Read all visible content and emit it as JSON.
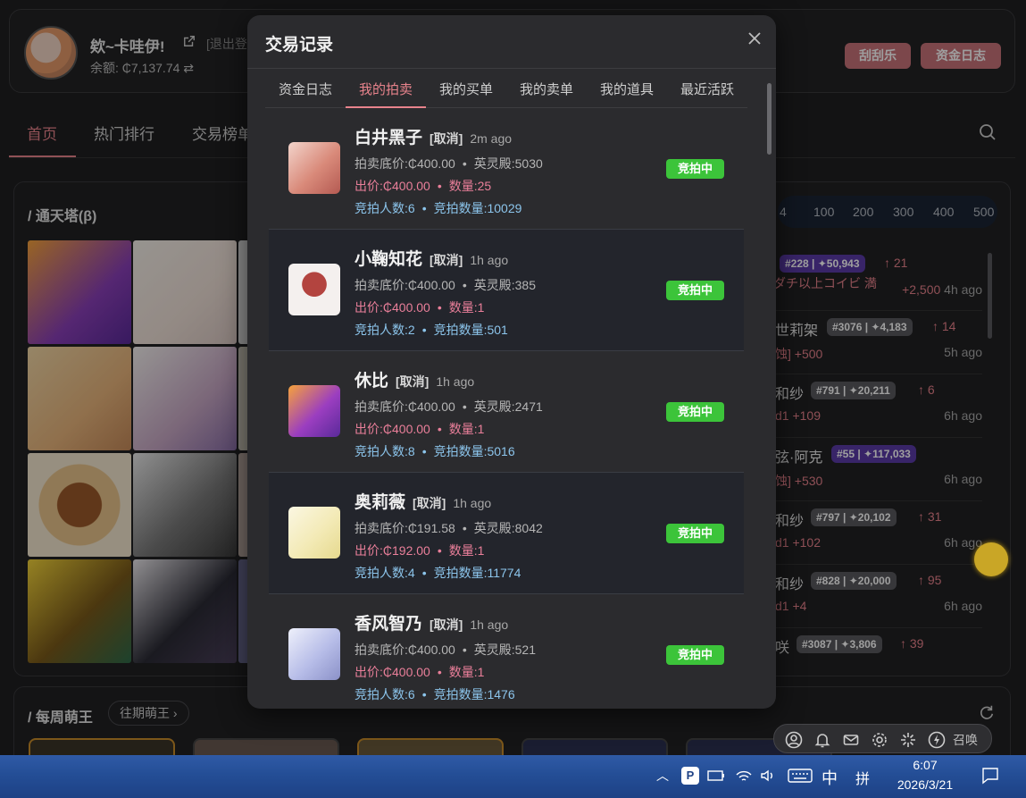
{
  "header": {
    "user_name": "欸~卡哇伊!",
    "logout": "[退出登",
    "balance": "余额: ₵7,137.74 ⇄",
    "buttons": [
      "刮刮乐",
      "资金日志"
    ]
  },
  "nav": {
    "items": [
      "首页",
      "热门排行",
      "交易榜单"
    ],
    "active": "首页"
  },
  "tower": {
    "title": "/ 通天塔(β)",
    "pager": [
      "4",
      "100",
      "200",
      "300",
      "400",
      "500"
    ]
  },
  "ranking": [
    {
      "name": "",
      "badge_no": "#228",
      "badge_val": "50,943",
      "up": "↑ 21",
      "sub": "モダチ以上コイビ 満",
      "extra": "+2,500",
      "time": "4h ago",
      "badge_color": "#5b3aa8"
    },
    {
      "name": "世莉架",
      "badge_no": "#3076",
      "badge_val": "4,183",
      "up": "↑ 14",
      "sub": "蚀] +500",
      "extra": "",
      "time": "5h ago",
      "badge_color": "#5a5a5e"
    },
    {
      "name": "和纱",
      "badge_no": "#791",
      "badge_val": "20,211",
      "up": "↑ 6",
      "sub": "d1 +109",
      "extra": "",
      "time": "6h ago",
      "badge_color": "#5a5a5e"
    },
    {
      "name": "弦·阿克",
      "badge_no": "#55",
      "badge_val": "117,033",
      "up": "",
      "sub": "蚀] +530",
      "extra": "",
      "time": "6h ago",
      "badge_color": "#5b3aa8"
    },
    {
      "name": "和纱",
      "badge_no": "#797",
      "badge_val": "20,102",
      "up": "↑ 31",
      "sub": "d1 +102",
      "extra": "",
      "time": "6h ago",
      "badge_color": "#5a5a5e"
    },
    {
      "name": "和纱",
      "badge_no": "#828",
      "badge_val": "20,000",
      "up": "↑ 95",
      "sub": "d1 +4",
      "extra": "",
      "time": "6h ago",
      "badge_color": "#5a5a5e"
    },
    {
      "name": "咲",
      "badge_no": "#3087",
      "badge_val": "3,806",
      "up": "↑ 39",
      "sub": "",
      "extra": "",
      "time": "",
      "badge_color": "#5a5a5e"
    }
  ],
  "weekly": {
    "title": "/ 每周萌王",
    "button": "往期萌王 ›"
  },
  "toolbar": {
    "summon": "召唤"
  },
  "modal": {
    "title": "交易记录",
    "tabs": [
      "资金日志",
      "我的拍卖",
      "我的买单",
      "我的卖单",
      "我的道具",
      "最近活跃"
    ],
    "active_tab": "我的拍卖",
    "labels": {
      "cancel": "[取消]",
      "floor": "拍卖底价:",
      "palace": "英灵殿:",
      "bid": "出价:",
      "qty": "数量:",
      "bidders": "竞拍人数:",
      "bid_qty": "竞拍数量:",
      "dot": "•"
    },
    "records": [
      {
        "name": "白井黑子",
        "ago": "2m ago",
        "floor": "₵400.00",
        "palace": "5030",
        "bid": "₵400.00",
        "qty": "25",
        "bidders": "6",
        "bid_qty": "10029",
        "status": "竞拍中",
        "color": "#e6a39a"
      },
      {
        "name": "小鞠知花",
        "ago": "1h ago",
        "floor": "₵400.00",
        "palace": "385",
        "bid": "₵400.00",
        "qty": "1",
        "bidders": "2",
        "bid_qty": "501",
        "status": "竞拍中",
        "color": "#b3443f"
      },
      {
        "name": "休比",
        "ago": "1h ago",
        "floor": "₵400.00",
        "palace": "2471",
        "bid": "₵400.00",
        "qty": "1",
        "bidders": "8",
        "bid_qty": "5016",
        "status": "竞拍中",
        "color": "#9b3ec0"
      },
      {
        "name": "奥莉薇",
        "ago": "1h ago",
        "floor": "₵191.58",
        "palace": "8042",
        "bid": "₵192.00",
        "qty": "1",
        "bidders": "4",
        "bid_qty": "11774",
        "status": "竞拍中",
        "color": "#f3eab6"
      },
      {
        "name": "香风智乃",
        "ago": "1h ago",
        "floor": "₵400.00",
        "palace": "521",
        "bid": "₵400.00",
        "qty": "1",
        "bidders": "6",
        "bid_qty": "1476",
        "status": "竞拍中",
        "color": "#b7bde8"
      }
    ]
  },
  "taskbar": {
    "ime1": "中",
    "ime2": "拼",
    "time": "6:07",
    "date": "2026/3/21"
  },
  "colors": {
    "accent": "#e8838c",
    "status_green": "#3cc43a",
    "bid_pink": "#ea7f9a",
    "info_blue": "#8cc5ec",
    "button_red": "#c9737a"
  },
  "icons": [
    "external-link-icon",
    "search-icon",
    "close-icon",
    "refresh-icon",
    "user-icon",
    "bell-icon",
    "mail-icon",
    "gear-icon",
    "sparkle-icon",
    "bolt-icon"
  ]
}
